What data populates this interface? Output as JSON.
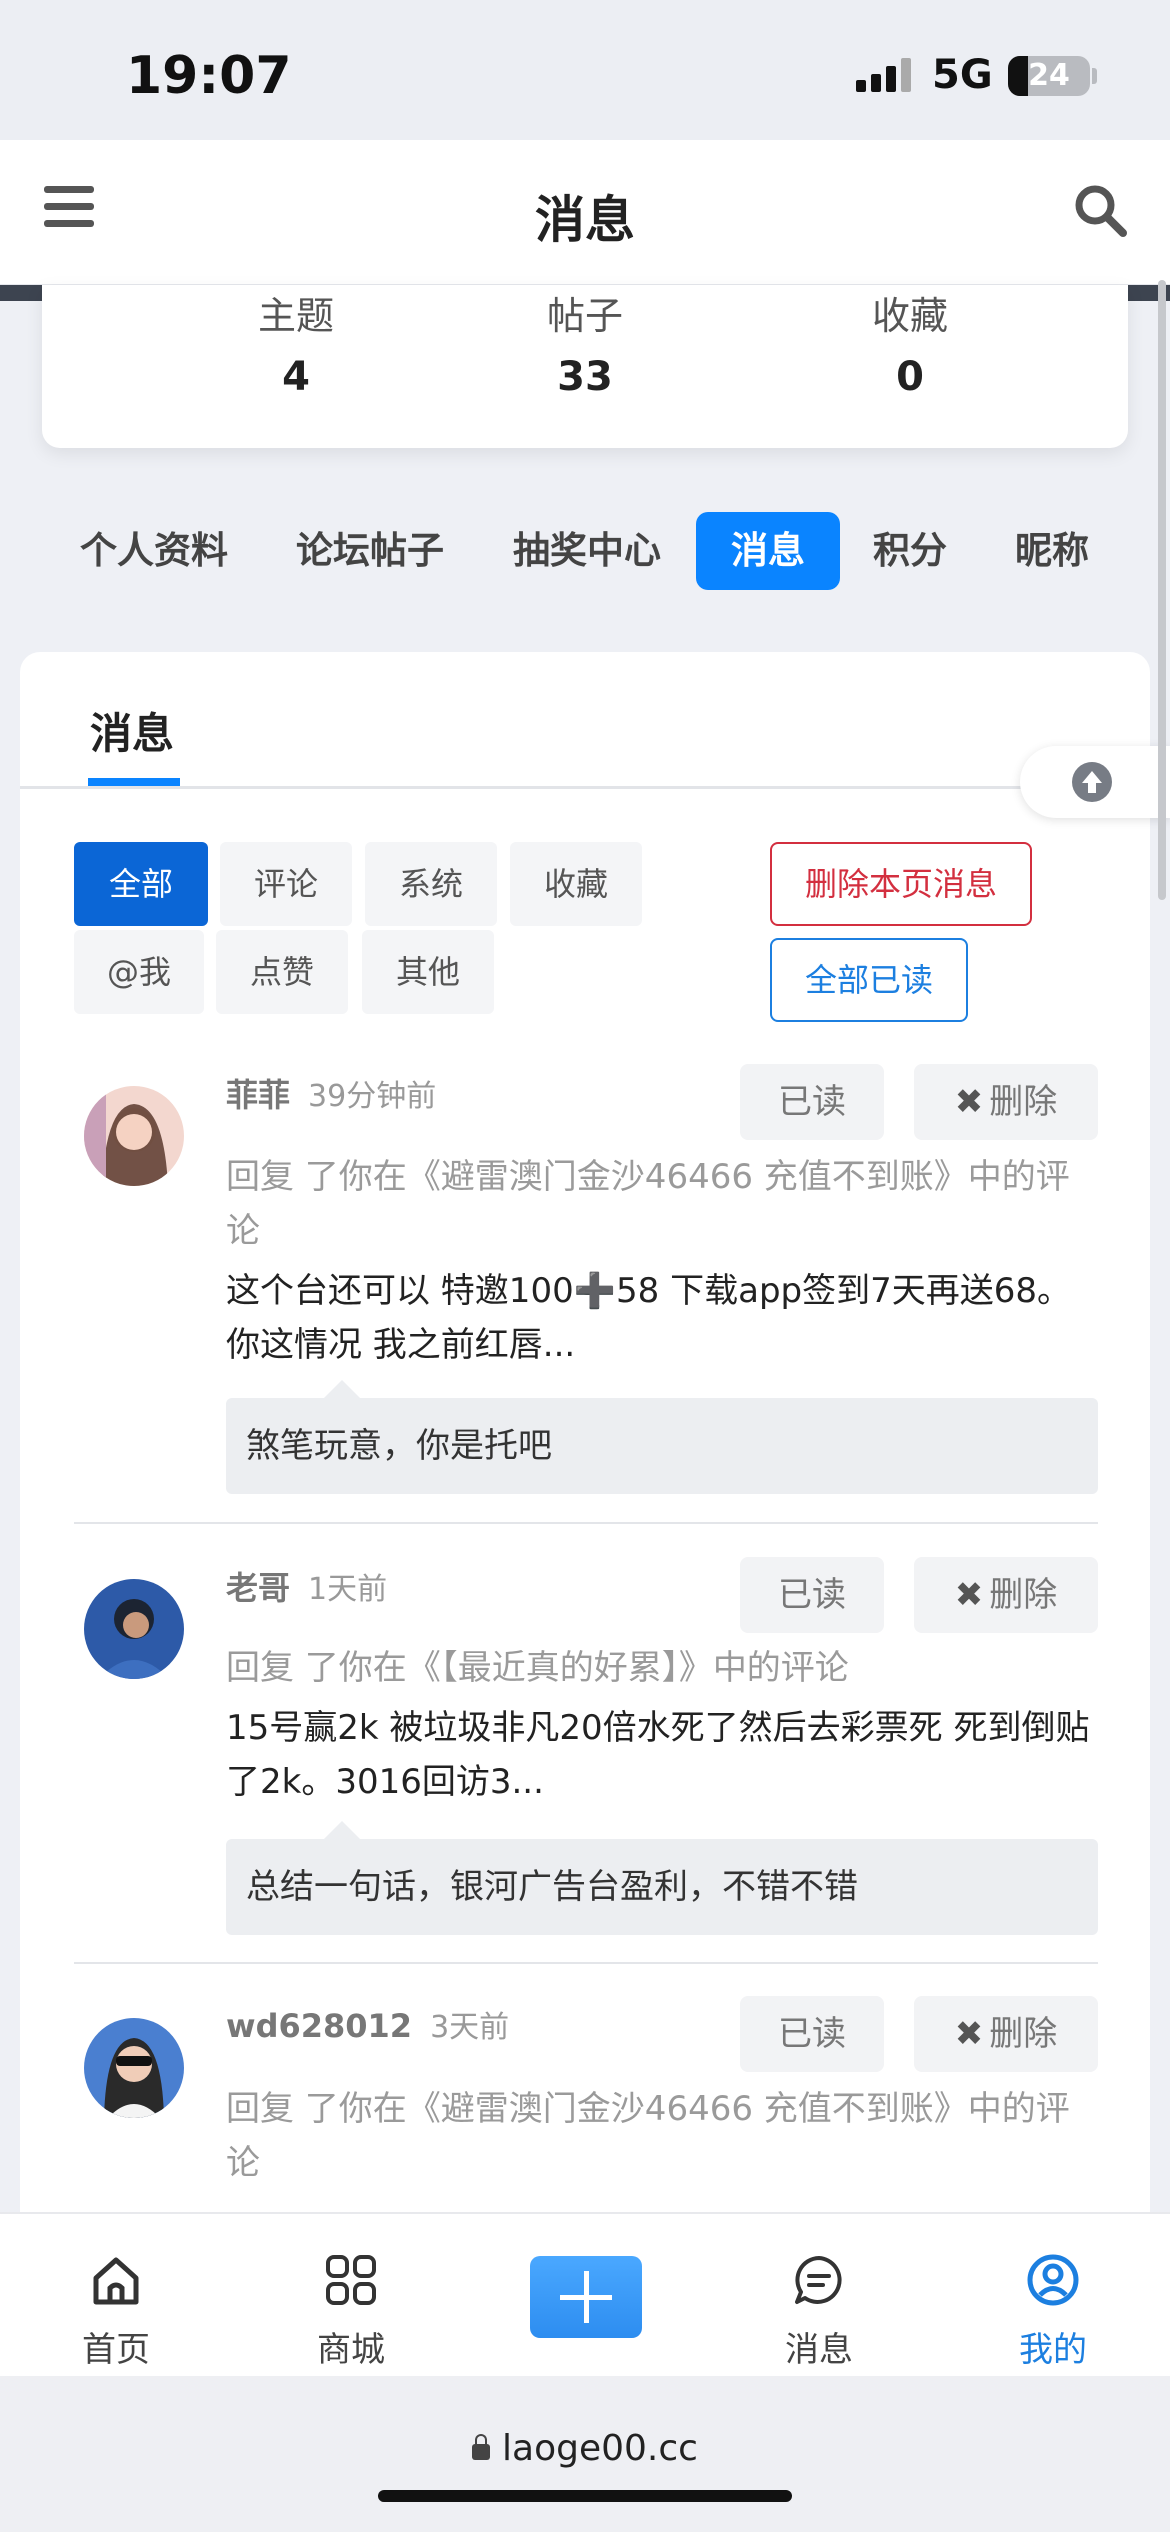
{
  "status_bar": {
    "time": "19:07",
    "network": "5G",
    "battery": "24"
  },
  "header": {
    "title": "消息"
  },
  "stats": [
    {
      "label": "主题",
      "value": "4"
    },
    {
      "label": "帖子",
      "value": "33"
    },
    {
      "label": "收藏",
      "value": "0"
    }
  ],
  "profile_tabs": [
    "个人资料",
    "论坛帖子",
    "抽奖中心",
    "消息",
    "积分",
    "昵称"
  ],
  "panel": {
    "tab": "消息",
    "filters": [
      "全部",
      "评论",
      "系统",
      "收藏",
      "@我",
      "点赞",
      "其他"
    ],
    "delete_page_label": "删除本页消息",
    "mark_all_read_label": "全部已读"
  },
  "messages": [
    {
      "name": "菲菲",
      "time": "39分钟前",
      "read_label": "已读",
      "delete_label": "删除",
      "desc_prefix": "回复 了你在",
      "desc_topic": "《避雷澳门金沙46466 充值不到账》",
      "desc_suffix": "中的评论",
      "content": "这个台还可以 特邀100➕58 下载app签到7天再送68。你这情况 我之前红唇...",
      "quote": "煞笔玩意，你是托吧"
    },
    {
      "name": "老哥",
      "time": "1天前",
      "read_label": "已读",
      "delete_label": "删除",
      "desc_prefix": "回复 了你在",
      "desc_topic": "《【最近真的好累】》",
      "desc_suffix": "中的评论",
      "content": "15号赢2k 被垃圾非凡20倍水死了然后去彩票死 死到倒贴了2k。3016回访3...",
      "quote": "总结一句话，银河广告台盈利，不错不错"
    },
    {
      "name": "wd628012",
      "time": "3天前",
      "read_label": "已读",
      "delete_label": "删除",
      "desc_prefix": "回复 了你在",
      "desc_topic": "《避雷澳门金沙46466 充值不到账》",
      "desc_suffix": "中的评论",
      "content": "",
      "quote": ""
    }
  ],
  "bottom_nav": [
    "首页",
    "商城",
    "消息",
    "我的"
  ],
  "url_bar": {
    "url": "laoge00.cc"
  },
  "colors": {
    "accent": "#0a84ff",
    "danger": "#d32f3f",
    "active_filter": "#0b66d6"
  }
}
